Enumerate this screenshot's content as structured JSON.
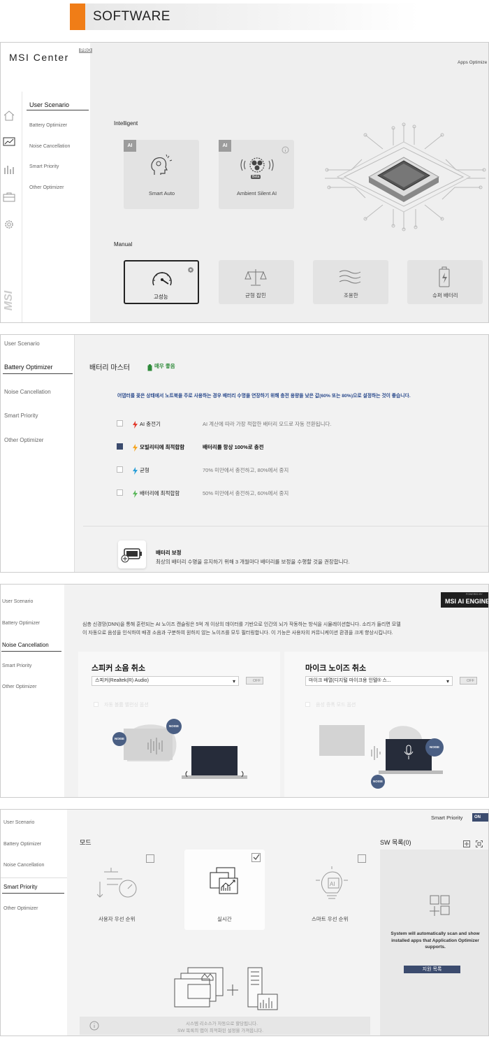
{
  "header": {
    "title": "SOFTWARE"
  },
  "panel1": {
    "logo": "MSI Center",
    "logo_badge": "PRO",
    "top_right": "Apps Optimize",
    "sidebar": [
      "User Scenario",
      "Battery Optimizer",
      "Noise Cancellation",
      "Smart Priority",
      "Other Optimizer"
    ],
    "intelligent_label": "Intelligent",
    "intelligent_cards": [
      {
        "badge": "AI",
        "label": "Smart Auto"
      },
      {
        "badge": "AI",
        "label": "Ambient Silent AI",
        "tag": "Beta"
      }
    ],
    "manual_label": "Manual",
    "manual_cards": [
      "고성능",
      "균형 잡힌",
      "조용한",
      "슈퍼 배터리"
    ]
  },
  "panel2": {
    "sidebar": [
      "User Scenario",
      "Battery Optimizer",
      "Noise Cancellation",
      "Smart Priority",
      "Other Optimizer"
    ],
    "title": "배터리 마스터",
    "status": "매우 좋음",
    "notice": "어댑터를 꽂은 상태에서 노트북을 주로 사용하는 경우 배터리 수명을 연장하기 위해 충전 용량을 낮은 값(60% 또는 80%)으로 설정하는 것이 좋습니다.",
    "options": [
      {
        "name": "AI 충전기",
        "desc": "AI 계산에 따라 가장 적합한 배터리 모드로 자동 전환됩니다.",
        "checked": false,
        "color": "#e23b2e"
      },
      {
        "name": "모빌리티에 최적합함",
        "desc": "배터리를 항상 100%로 충전",
        "checked": true,
        "color": "#f5a623"
      },
      {
        "name": "균형",
        "desc": "70% 미만에서 충전하고, 80%에서 중지",
        "checked": false,
        "color": "#2a9fd8"
      },
      {
        "name": "배터리에 최적합함",
        "desc": "50% 미만에서 충전하고, 60%에서 중지",
        "checked": false,
        "color": "#5cb85c"
      }
    ],
    "calib_title": "배터리 보정",
    "calib_desc": "최상의 배터리 수명을 유지하기 위해 3 개월마다 배터리를 보정을 수행할 것을 권장합니다."
  },
  "panel3": {
    "sidebar": [
      "User Scenario",
      "Battery Optimizer",
      "Noise Cancellation",
      "Smart Priority",
      "Other Optimizer"
    ],
    "brand_small": "POWERED BY",
    "brand": "MSI AI ENGINE",
    "desc1": "심층 신경망(DNN)을 통해 훈련되는 AI 노이즈 캔슬링은 5억 개 이상의 데이터를 기반으로 인간의 뇌가 작동하는 방식을 시뮬레이션합니다. 소리가 들리면 모델",
    "desc2": "이 자동으로 음성을 인식하여 배경 소음과 구분하여 원하지 않는 노이즈를 모두 필터링합니다. 이 기능은 사용자의 커뮤니케이션 환경을 크게 향상시킵니다.",
    "speaker": {
      "title": "스피커 소음 취소",
      "device": "스피커(Realtek(R) Audio)",
      "toggle": "OFF",
      "option": "자동 볼륨 밸런싱 옵션"
    },
    "mic": {
      "title": "마이크 노이즈 취소",
      "device": "마이크 배열(디지털 마이크용 인텔® 스...",
      "toggle": "OFF",
      "option": "음성 증폭 모드 옵션"
    },
    "noise": "NOISE"
  },
  "panel4": {
    "sidebar": [
      "User Scenario",
      "Battery Optimizer",
      "Noise Cancellation",
      "Smart Priority",
      "Other Optimizer"
    ],
    "smart_priority_label": "Smart Priority",
    "smart_priority_toggle": "ON",
    "mode_label": "모드",
    "sw_list": "SW 목록(0)",
    "modes": [
      "사용자 우선 순위",
      "실시간",
      "스마트 우선 순위"
    ],
    "sw_info": "System will automatically scan and show installed apps that Application Optimizer supports.",
    "support_btn": "지원 목록",
    "footer1": "시스템 리소스가 자동으로 할당됩니다.",
    "footer2": "SW 목록의 앱이 최적화된 설정을 가져옵니다."
  }
}
